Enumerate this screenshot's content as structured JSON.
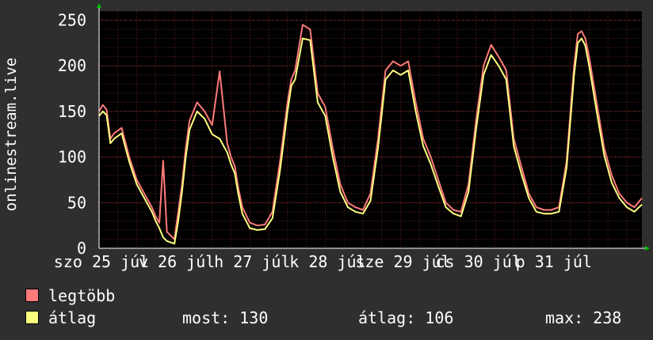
{
  "chart_data": {
    "type": "area",
    "ylabel": "onlinestream.live",
    "ylim": [
      0,
      260
    ],
    "yticks": [
      0,
      50,
      100,
      150,
      200,
      250
    ],
    "xlim": [
      0,
      7.2
    ],
    "x_tick_labels": [
      "szo 25 júl",
      "v 26 júl",
      "h 27 júl",
      "k 28 júl",
      "sze 29 júl",
      "cs 30 júl",
      "p 31 júl"
    ],
    "grid": true,
    "colors": {
      "background": "#000000",
      "outer": "#2f2f2f",
      "grid": "#5a1f1f",
      "max": "#ff7a7a",
      "avg": "#ffff80"
    },
    "series": [
      {
        "name": "legtöbb",
        "x": [
          0.0,
          0.05,
          0.1,
          0.15,
          0.2,
          0.3,
          0.4,
          0.5,
          0.6,
          0.7,
          0.75,
          0.8,
          0.85,
          0.9,
          1.0,
          1.05,
          1.1,
          1.15,
          1.2,
          1.3,
          1.4,
          1.5,
          1.6,
          1.7,
          1.75,
          1.8,
          1.85,
          1.9,
          2.0,
          2.1,
          2.2,
          2.3,
          2.4,
          2.5,
          2.55,
          2.6,
          2.7,
          2.8,
          2.9,
          3.0,
          3.1,
          3.2,
          3.3,
          3.4,
          3.5,
          3.6,
          3.7,
          3.8,
          3.9,
          4.0,
          4.1,
          4.2,
          4.3,
          4.4,
          4.5,
          4.6,
          4.7,
          4.8,
          4.9,
          5.0,
          5.1,
          5.2,
          5.3,
          5.4,
          5.5,
          5.6,
          5.7,
          5.8,
          5.9,
          6.0,
          6.1,
          6.2,
          6.3,
          6.35,
          6.4,
          6.45,
          6.5,
          6.6,
          6.7,
          6.8,
          6.9,
          7.0,
          7.1,
          7.2
        ],
        "values": [
          150,
          157,
          152,
          120,
          126,
          132,
          100,
          75,
          60,
          45,
          35,
          28,
          96,
          18,
          10,
          40,
          70,
          110,
          140,
          160,
          150,
          135,
          194,
          115,
          100,
          90,
          65,
          45,
          28,
          25,
          26,
          40,
          95,
          160,
          185,
          195,
          245,
          240,
          170,
          155,
          110,
          70,
          50,
          45,
          42,
          60,
          120,
          195,
          205,
          200,
          205,
          160,
          120,
          100,
          75,
          50,
          42,
          40,
          70,
          140,
          200,
          223,
          210,
          195,
          120,
          90,
          60,
          45,
          42,
          42,
          45,
          95,
          200,
          235,
          238,
          230,
          210,
          160,
          110,
          80,
          60,
          50,
          45,
          55
        ]
      },
      {
        "name": "átlag",
        "x": [
          0.0,
          0.05,
          0.1,
          0.15,
          0.2,
          0.3,
          0.4,
          0.5,
          0.6,
          0.7,
          0.75,
          0.8,
          0.85,
          0.9,
          1.0,
          1.05,
          1.1,
          1.15,
          1.2,
          1.3,
          1.4,
          1.5,
          1.6,
          1.7,
          1.75,
          1.8,
          1.85,
          1.9,
          2.0,
          2.1,
          2.2,
          2.3,
          2.4,
          2.5,
          2.55,
          2.6,
          2.7,
          2.8,
          2.9,
          3.0,
          3.1,
          3.2,
          3.3,
          3.4,
          3.5,
          3.6,
          3.7,
          3.8,
          3.9,
          4.0,
          4.1,
          4.2,
          4.3,
          4.4,
          4.5,
          4.6,
          4.7,
          4.8,
          4.9,
          5.0,
          5.1,
          5.2,
          5.3,
          5.4,
          5.5,
          5.6,
          5.7,
          5.8,
          5.9,
          6.0,
          6.1,
          6.2,
          6.3,
          6.35,
          6.4,
          6.45,
          6.5,
          6.6,
          6.7,
          6.8,
          6.9,
          7.0,
          7.1,
          7.2
        ],
        "values": [
          145,
          150,
          146,
          115,
          120,
          126,
          95,
          70,
          55,
          40,
          30,
          22,
          12,
          8,
          5,
          30,
          62,
          100,
          130,
          150,
          142,
          125,
          120,
          105,
          92,
          82,
          58,
          38,
          22,
          20,
          21,
          33,
          85,
          150,
          178,
          185,
          230,
          228,
          160,
          145,
          100,
          62,
          45,
          40,
          38,
          52,
          110,
          185,
          195,
          190,
          195,
          150,
          112,
          92,
          68,
          45,
          38,
          35,
          62,
          130,
          190,
          212,
          200,
          185,
          112,
          82,
          55,
          40,
          38,
          38,
          40,
          88,
          190,
          225,
          230,
          222,
          200,
          150,
          102,
          72,
          55,
          45,
          40,
          48
        ]
      }
    ]
  },
  "legend": [
    {
      "label": "legtöbb",
      "color": "#ff7a7a"
    },
    {
      "label": "átlag",
      "color": "#ffff80"
    }
  ],
  "stats": {
    "most": "most: 130",
    "atlag": "átlag: 106",
    "max": "max: 238"
  }
}
